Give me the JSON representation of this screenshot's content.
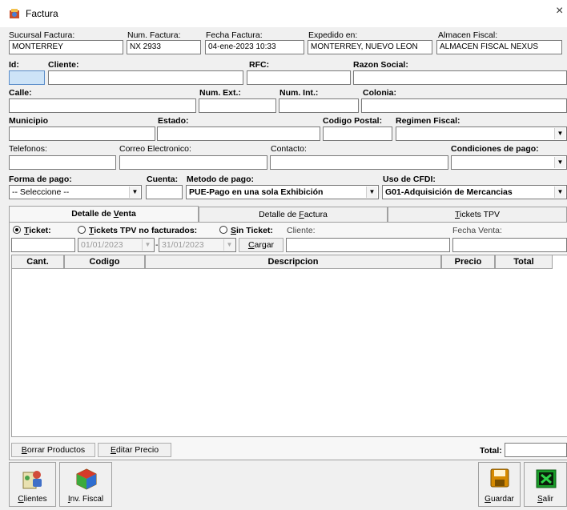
{
  "window": {
    "title": "Factura",
    "close_glyph": "×"
  },
  "header": {
    "sucursal_label": "Sucursal Factura:",
    "sucursal_value": "MONTERREY",
    "num_factura_label": "Num. Factura:",
    "num_factura_value": "NX 2933",
    "fecha_label": "Fecha Factura:",
    "fecha_value": "04-ene-2023 10:33",
    "expedido_label": "Expedido en:",
    "expedido_value": "MONTERREY, NUEVO LEON",
    "almacen_label": "Almacen Fiscal:",
    "almacen_value": "ALMACEN FISCAL NEXUS"
  },
  "cliente": {
    "id_label": "Id:",
    "cliente_label": "Cliente:",
    "rfc_label": "RFC:",
    "razon_label": "Razon Social:",
    "calle_label": "Calle:",
    "num_ext_label": "Num. Ext.:",
    "num_int_label": "Num. Int.:",
    "colonia_label": "Colonia:",
    "municipio_label": "Municipio",
    "estado_label": "Estado:",
    "cp_label": "Codigo Postal:",
    "regimen_label": "Regimen Fiscal:",
    "telefonos_label": "Telefonos:",
    "correo_label": "Correo Electronico:",
    "contacto_label": "Contacto:",
    "condiciones_label": "Condiciones de pago:",
    "forma_label": "Forma de pago:",
    "cuenta_label": "Cuenta:",
    "metodo_label": "Metodo de pago:",
    "uso_label": "Uso de CFDI:",
    "forma_value": "-- Seleccione --",
    "metodo_value": "PUE-Pago en una sola Exhibición",
    "uso_value": "G01-Adquisición de Mercancias"
  },
  "tabs": [
    {
      "pre": "Detalle de ",
      "key": "V",
      "post": "enta"
    },
    {
      "pre": "Detalle de ",
      "key": "F",
      "post": "actura"
    },
    {
      "pre": "",
      "key": "T",
      "post": "ickets TPV"
    }
  ],
  "venta": {
    "ticket_key": "T",
    "ticket_rest": "icket:",
    "tickets_key": "T",
    "tickets_rest": "ickets TPV no facturados:",
    "sin_key": "S",
    "sin_rest": "in Ticket:",
    "cliente_label": "Cliente:",
    "fecha_venta_label": "Fecha Venta:",
    "date_from": "01/01/2023",
    "date_to": "31/01/2023",
    "date_sep": "-",
    "cargar_key": "C",
    "cargar_rest": "argar"
  },
  "grid": {
    "columns": [
      "Cant.",
      "Codigo",
      "Descripcion",
      "Precio",
      "Total"
    ]
  },
  "footer": {
    "borrar_key": "B",
    "borrar_rest": "orrar Productos",
    "editar_key": "E",
    "editar_rest": "ditar Precio",
    "total_label": "Total:"
  },
  "toolbar": {
    "clientes_key": "C",
    "clientes_rest": "lientes",
    "inv_key": "I",
    "inv_rest": "nv. Fiscal",
    "guardar_key": "G",
    "guardar_rest": "uardar",
    "salir_key": "S",
    "salir_rest": "alir"
  },
  "icons": {
    "app": "app-icon",
    "clientes": "clients-icon",
    "inv": "inventory-cube-icon",
    "guardar": "save-disk-icon",
    "salir": "exit-icon"
  },
  "colors": {
    "focus_field": "#cde3f7",
    "save_icon": "#d68a00",
    "exit_icon": "#1a9c2a"
  }
}
